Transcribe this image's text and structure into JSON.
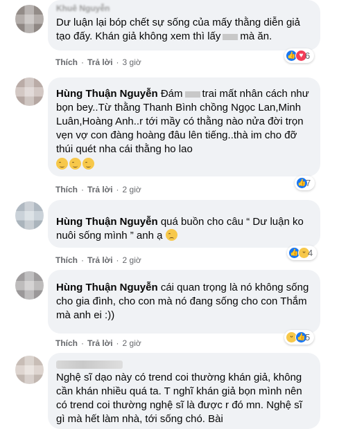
{
  "comments": [
    {
      "author": "Khuê Nguyễn",
      "text": "Dư luận lại bóp chết sự sống của mấy thằng diễn giả tạo đấy. Khán giả không xem thì lấy",
      "text_tail": "mà ăn.",
      "like_label": "Thích",
      "reply_label": "Trả lời",
      "time": "3 giờ",
      "reaction_count": "6",
      "reaction_icons": [
        "like-icon",
        "love-icon"
      ]
    },
    {
      "author": "Hùng Thuận Nguyễn",
      "text_pre": "Đám",
      "text": "trai mất nhân cách như bọn bey..Từ thằng Thanh Bình chồng Ngọc Lan,Minh Luân,Hoàng Anh..r tới mầy có thằng nào nửa đời trọn vẹn vợ con đàng hoàng đâu lên tiếng..thà im cho đỡ thúi quét nha cái thằng ho lao",
      "like_label": "Thích",
      "reply_label": "Trả lời",
      "time": "2 giờ",
      "reaction_count": "7",
      "reaction_icons": [
        "like-icon"
      ]
    },
    {
      "author": "Hùng Thuận Nguyễn",
      "text": "quá buồn cho câu “ Dư luận ko nuôi sống mình ” anh ạ",
      "like_label": "Thích",
      "reply_label": "Trả lời",
      "time": "2 giờ",
      "reaction_count": "4",
      "reaction_icons": [
        "like-icon",
        "haha-icon"
      ]
    },
    {
      "author": "Hùng Thuận Nguyễn",
      "text": "cái quan trọng là nó không sống cho gia đình, cho con mà nó đang sống cho con Thắm mà anh ei :))",
      "like_label": "Thích",
      "reply_label": "Trả lời",
      "time": "2 giờ",
      "reaction_count": "5",
      "reaction_icons": [
        "haha-icon",
        "like-icon"
      ]
    },
    {
      "author": "",
      "text": "Nghệ sĩ dạo này có trend coi thường khán giả, không cần khán nhiều quá ta. T nghĩ khán giả bọn mình nên có trend coi thường nghệ sĩ là được r đó mn. Nghệ sĩ gì mà hết làm nhà, tới sống chó. Bài"
    }
  ]
}
